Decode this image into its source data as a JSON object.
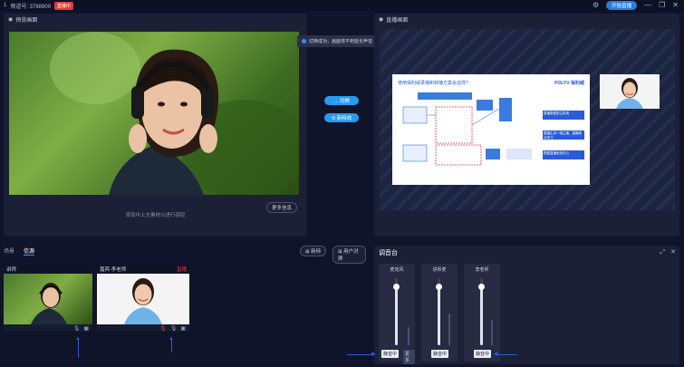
{
  "titlebar": {
    "app_num": "1",
    "room_label": "频道号: 3788900",
    "live_badge": "直播中",
    "start_button": "开始直播"
  },
  "preview": {
    "title": "预览画面",
    "hint": "添加中上方素材以进行调控",
    "more_button": "更多信息"
  },
  "live": {
    "title": "直播画面"
  },
  "center": {
    "switch_button": "→ 切换",
    "ppt_button": "⟲ 新特效"
  },
  "toast": {
    "text": "切换成功，画面将不到延长声音"
  },
  "slide": {
    "title": "使用保利威录播和转播方案会这样?",
    "brand": "POLYV 保利威",
    "boxes": [
      "直播数据到主机端",
      "直播主讲一端主播，直播观众学习",
      "数据直播系统中心"
    ]
  },
  "bottom": {
    "tabs": [
      "场景",
      "信源"
    ],
    "active_tab": 1,
    "effect_button": "⊞ 新特",
    "scene_button": "⊞ 用户对屏",
    "sources": [
      {
        "name": "讲师",
        "tag": ""
      },
      {
        "name": "嘉宾-李老师",
        "tag": "直播"
      }
    ]
  },
  "mixer": {
    "title": "调音台",
    "channels": [
      {
        "name": "麦克风",
        "mute": "静音中",
        "extra": "更多",
        "level": 0.87
      },
      {
        "name": "讲师麦",
        "mute": "静音中",
        "extra": "",
        "level": 0.87
      },
      {
        "name": "李老师",
        "mute": "静音中",
        "extra": "",
        "level": 0.87
      }
    ]
  },
  "colors": {
    "accent": "#2a9af0",
    "live": "#e23b3b",
    "bg": "#10142a",
    "panel": "#1b2036"
  }
}
